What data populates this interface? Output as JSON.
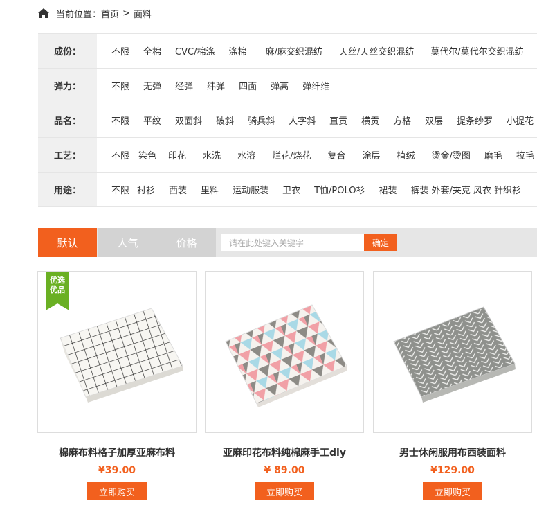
{
  "breadcrumb": {
    "label": "当前位置：",
    "home": "首页",
    "sep": ">",
    "current": "面料"
  },
  "filters": [
    {
      "label": "成份：",
      "options": [
        "不限",
        "全棉",
        "CVC/棉涤",
        "涤棉",
        "麻/麻交织混纺",
        "天丝/天丝交织混纺",
        "莫代尔/莫代尔交织混纺"
      ]
    },
    {
      "label": "弹力：",
      "options": [
        "不限",
        "无弹",
        "经弹",
        "纬弹",
        "四面",
        "弹高",
        "弹纤维"
      ]
    },
    {
      "label": "品名：",
      "options": [
        "不限",
        "平纹",
        "双面斜",
        "破斜",
        "骑兵斜",
        "人字斜",
        "直贡",
        "横贡",
        "方格",
        "双层",
        "提条纱罗",
        "小提花"
      ]
    },
    {
      "label": "工艺：",
      "options": [
        "不限",
        "染色",
        "印花",
        "水洗",
        "水溶",
        "烂花/烧花",
        "复合",
        "涂层",
        "植绒",
        "烫金/烫图",
        "磨毛",
        "拉毛"
      ]
    },
    {
      "label": "用途：",
      "options": [
        "不限",
        "衬衫",
        "西装",
        "里料",
        "运动服装",
        "卫衣",
        "T恤/POLO衫",
        "裙装",
        "裤装",
        "外套/夹克",
        "风衣",
        "针织衫"
      ]
    }
  ],
  "sort": {
    "tabs": [
      "默认",
      "人气",
      "价格"
    ],
    "search_placeholder": "请在此处键入关键字",
    "confirm": "确定"
  },
  "products": [
    {
      "name": "棉麻布料格子加厚亚麻布料",
      "price": "¥39.00",
      "buy": "立即购买",
      "badge": [
        "优选",
        "优品"
      ]
    },
    {
      "name": "亚麻印花布料纯棉麻手工diy",
      "price": "¥ 89.00",
      "buy": "立即购买"
    },
    {
      "name": "男士休闲服用布西装面料",
      "price": "¥129.00",
      "buy": "立即购买"
    }
  ],
  "colors": {
    "accent": "#f2601e",
    "badge": "#6ab023"
  }
}
